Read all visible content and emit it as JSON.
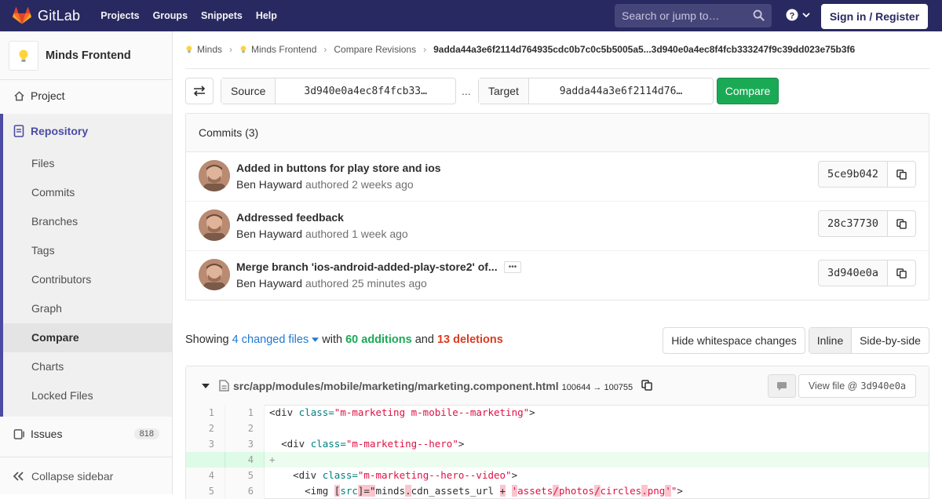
{
  "topbar": {
    "brand": "GitLab",
    "nav": [
      "Projects",
      "Groups",
      "Snippets",
      "Help"
    ],
    "search_placeholder": "Search or jump to…",
    "sign_in": "Sign in / Register"
  },
  "sidebar": {
    "project_title": "Minds Frontend",
    "project": "Project",
    "repository": "Repository",
    "sub_items": [
      "Files",
      "Commits",
      "Branches",
      "Tags",
      "Contributors",
      "Graph",
      "Compare",
      "Charts",
      "Locked Files"
    ],
    "issues": "Issues",
    "issues_count": "818",
    "collapse": "Collapse sidebar"
  },
  "breadcrumb": [
    "Minds",
    "Minds Frontend",
    "Compare Revisions",
    "9adda44a3e6f2114d764935cdc0b7c0c5b5005a5...3d940e0a4ec8f4fcb333247f9c39dd023e75b3f6"
  ],
  "compare": {
    "source_label": "Source",
    "source_value": "3d940e0a4ec8f4fcb33…",
    "separator": "...",
    "target_label": "Target",
    "target_value": "9adda44a3e6f2114d76…",
    "button": "Compare"
  },
  "commits": {
    "header": "Commits (3)",
    "items": [
      {
        "title": "Added in buttons for play store and ios",
        "author": "Ben Hayward",
        "meta": "authored 2 weeks ago",
        "sha": "5ce9b042"
      },
      {
        "title": "Addressed feedback",
        "author": "Ben Hayward",
        "meta": "authored 1 week ago",
        "sha": "28c37730"
      },
      {
        "title": "Merge branch 'ios-android-added-play-store2' of...",
        "author": "Ben Hayward",
        "meta": "authored 25 minutes ago",
        "sha": "3d940e0a"
      }
    ]
  },
  "stats": {
    "showing": "Showing",
    "changed": "4 changed files",
    "with": "with",
    "additions": "60 additions",
    "and": "and",
    "deletions": "13 deletions"
  },
  "view_controls": {
    "whitespace": "Hide whitespace changes",
    "inline": "Inline",
    "side_by_side": "Side-by-side"
  },
  "diff": {
    "file_path": "src/app/modules/mobile/marketing/marketing.component.html",
    "mode": "100644 → 100755",
    "view_file": "View file @",
    "view_file_sha": "3d940e0a",
    "lines": [
      {
        "old": "1",
        "new": "1"
      },
      {
        "old": "2",
        "new": "2"
      },
      {
        "old": "3",
        "new": "3"
      },
      {
        "old": "",
        "new": "4"
      },
      {
        "old": "4",
        "new": "5"
      },
      {
        "old": "5",
        "new": "6"
      }
    ]
  },
  "colors": {
    "nav_bg": "#292961",
    "accent": "#4b4ba3",
    "green": "#1aaa55",
    "red": "#db3b21",
    "link": "#1f78d1"
  }
}
